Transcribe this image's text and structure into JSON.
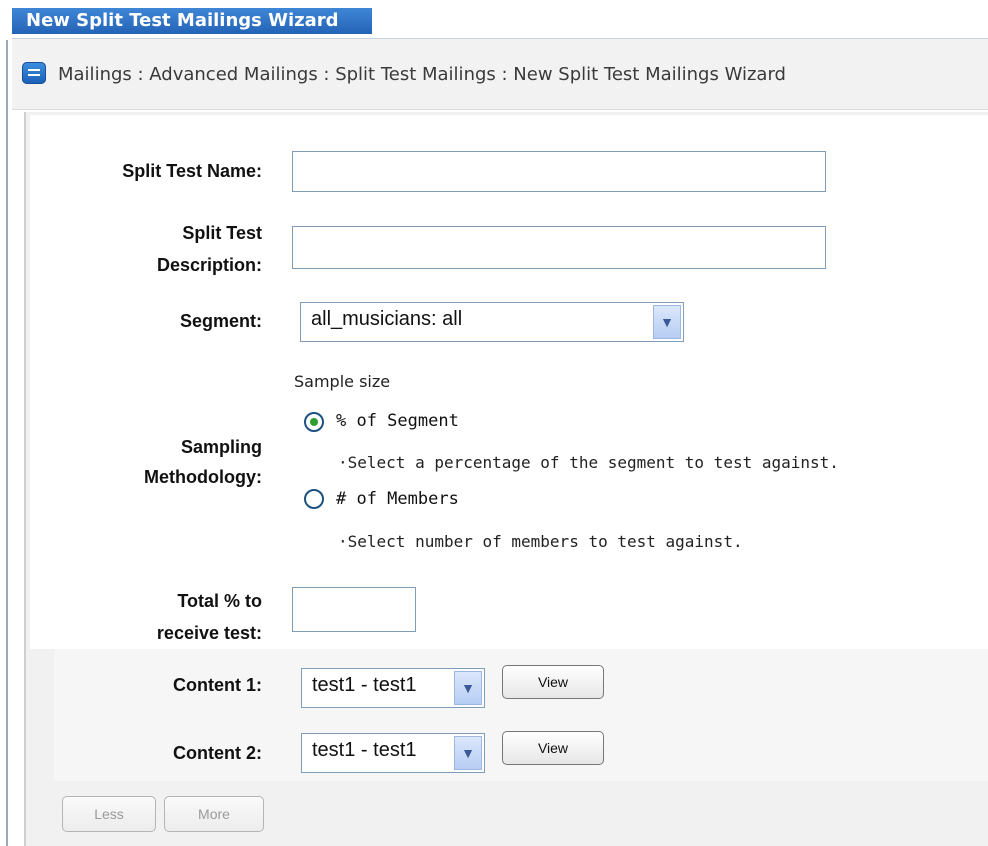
{
  "window": {
    "title": "New Split Test Mailings Wizard"
  },
  "breadcrumb": {
    "path": "Mailings : Advanced Mailings : Split Test Mailings : New Split Test Mailings Wizard"
  },
  "form": {
    "split_test_name_label": "Split Test Name:",
    "split_test_description_label_line1": "Split Test",
    "split_test_description_label_line2": "Description:",
    "segment_label": "Segment:",
    "segment_value": "all_musicians: all",
    "sampling_label_line1": "Sampling",
    "sampling_label_line2": "Methodology:",
    "sample_size_heading": "Sample size",
    "option_percent_label": "% of Segment",
    "option_percent_note": "·Select a percentage of the segment to test against.",
    "option_members_label": "# of Members",
    "option_members_note": "·Select number of members to test against.",
    "total_label_line1": "Total % to",
    "total_label_line2": "receive test:",
    "content1_label": "Content 1:",
    "content1_value": "test1 - test1",
    "content2_label": "Content 2:",
    "content2_value": "test1 - test1",
    "view_label": "View"
  },
  "buttons": {
    "less": "Less",
    "more": "More"
  },
  "icons": {
    "breadcrumb": "list-icon",
    "dropdown": "chevron-down-icon"
  }
}
